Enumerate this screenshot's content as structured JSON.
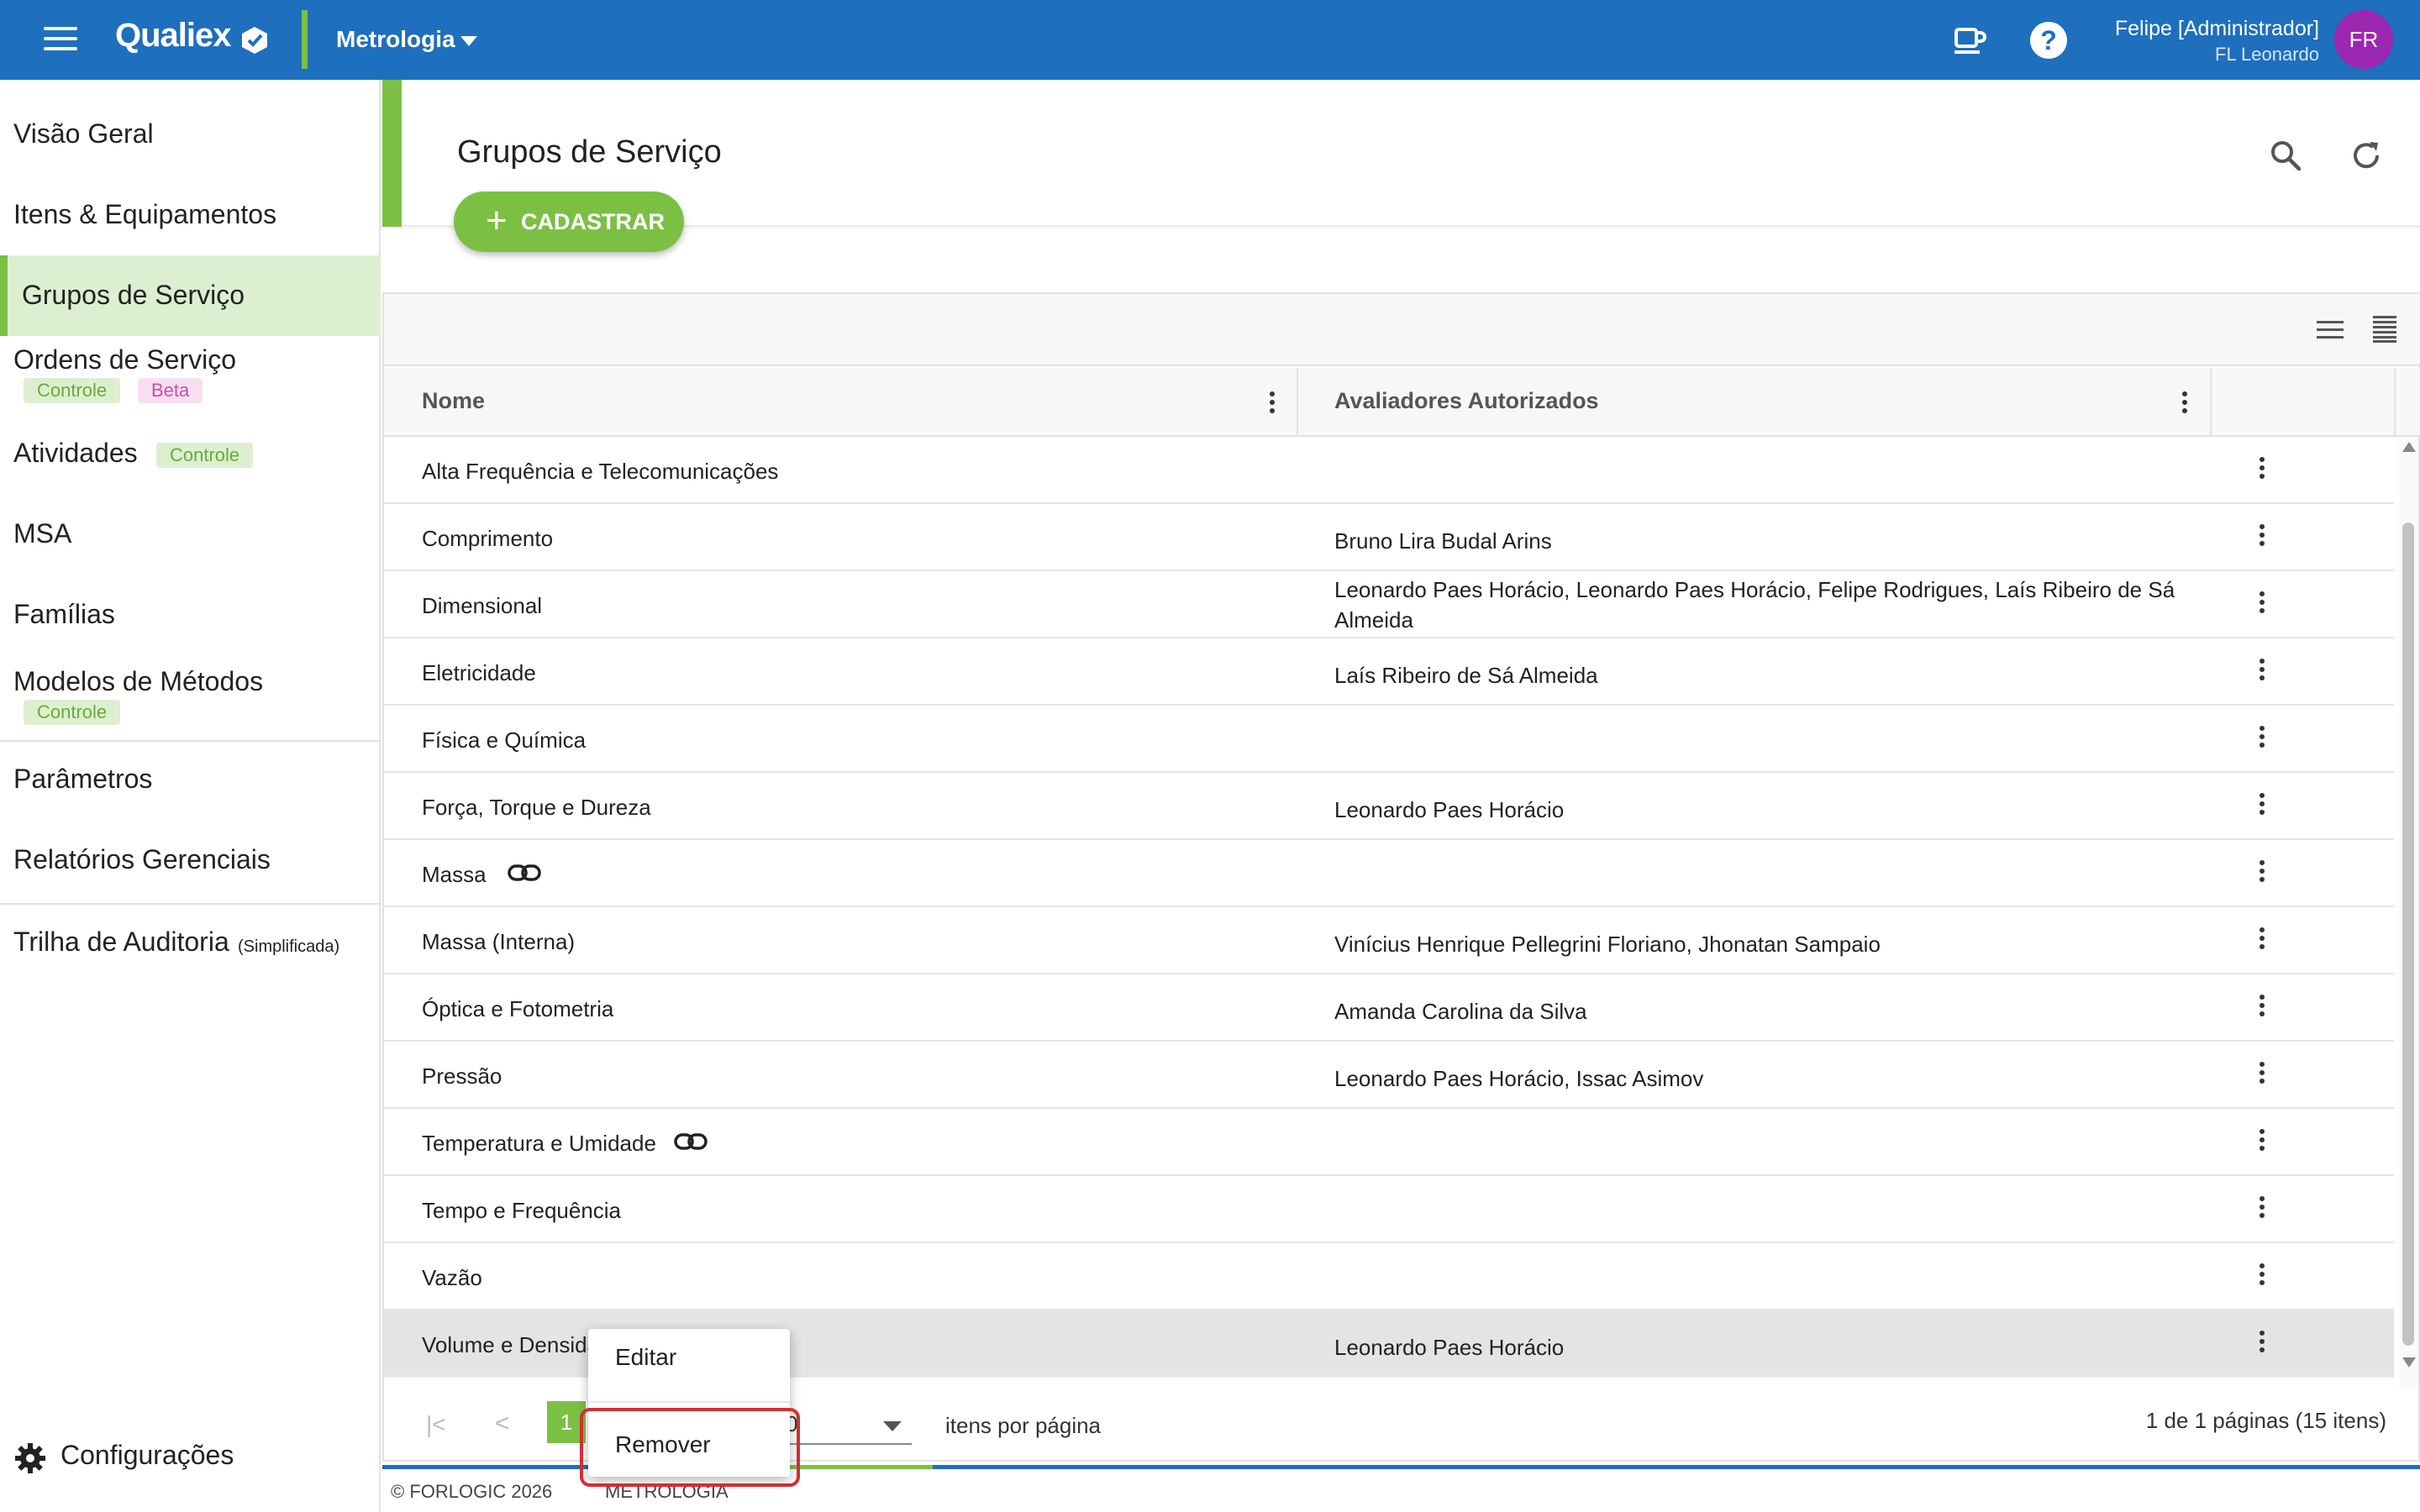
{
  "header": {
    "logo": "Qualiex",
    "module": "Metrologia",
    "user_name": "Felipe [Administrador]",
    "user_sub": "FL Leonardo",
    "avatar_initials": "FR",
    "bg_color": "#1e6fbd",
    "accent_color": "#7bc043"
  },
  "sidebar": {
    "items": [
      {
        "label": "Visão Geral"
      },
      {
        "label": "Itens & Equipamentos"
      },
      {
        "label": "Grupos de Serviço",
        "active": true
      },
      {
        "label": "Ordens de Serviço",
        "badges": [
          "Controle",
          "Beta"
        ]
      },
      {
        "label": "Atividades",
        "badges": [
          "Controle"
        ]
      },
      {
        "label": "MSA"
      },
      {
        "label": "Famílias"
      },
      {
        "label": "Modelos de Métodos",
        "badges": [
          "Controle"
        ]
      },
      {
        "label": "Parâmetros"
      },
      {
        "label": "Relatórios Gerenciais"
      },
      {
        "label": "Trilha de Auditoria",
        "suffix": "(Simplificada)"
      }
    ],
    "settings_label": "Configurações"
  },
  "page": {
    "title": "Grupos de Serviço",
    "add_button": "CADASTRAR"
  },
  "table": {
    "columns": [
      "Nome",
      "Avaliadores Autorizados"
    ],
    "rows": [
      {
        "name": "Alta Frequência e Telecomunicações",
        "evaluators": ""
      },
      {
        "name": "Comprimento",
        "evaluators": "Bruno Lira Budal Arins"
      },
      {
        "name": "Dimensional",
        "evaluators": "Leonardo Paes Horácio, Leonardo Paes Horácio, Felipe Rodrigues, Laís Ribeiro de Sá Almeida"
      },
      {
        "name": "Eletricidade",
        "evaluators": "Laís Ribeiro de Sá Almeida"
      },
      {
        "name": "Física e Química",
        "evaluators": ""
      },
      {
        "name": "Força, Torque e Dureza",
        "evaluators": "Leonardo Paes Horácio"
      },
      {
        "name": "Massa",
        "evaluators": "",
        "linked": true
      },
      {
        "name": "Massa (Interna)",
        "evaluators": "Vinícius Henrique Pellegrini Floriano, Jhonatan Sampaio"
      },
      {
        "name": "Óptica e Fotometria",
        "evaluators": "Amanda Carolina da Silva"
      },
      {
        "name": "Pressão",
        "evaluators": "Leonardo Paes Horácio, Issac Asimov"
      },
      {
        "name": "Temperatura e Umidade",
        "evaluators": "",
        "linked": true
      },
      {
        "name": "Tempo e Frequência",
        "evaluators": ""
      },
      {
        "name": "Vazão",
        "evaluators": ""
      },
      {
        "name": "Volume e Densida",
        "evaluators": "Leonardo Paes Horácio",
        "selected": true
      }
    ]
  },
  "pagination": {
    "current_page": "1",
    "per_page_partial": "0",
    "per_page_label": "itens por página",
    "summary": "1 de 1 páginas (15 itens)"
  },
  "context_menu": {
    "edit": "Editar",
    "remove": "Remover"
  },
  "footer": {
    "copyright": "© FORLOGIC 2026",
    "module": "Metrologia"
  }
}
